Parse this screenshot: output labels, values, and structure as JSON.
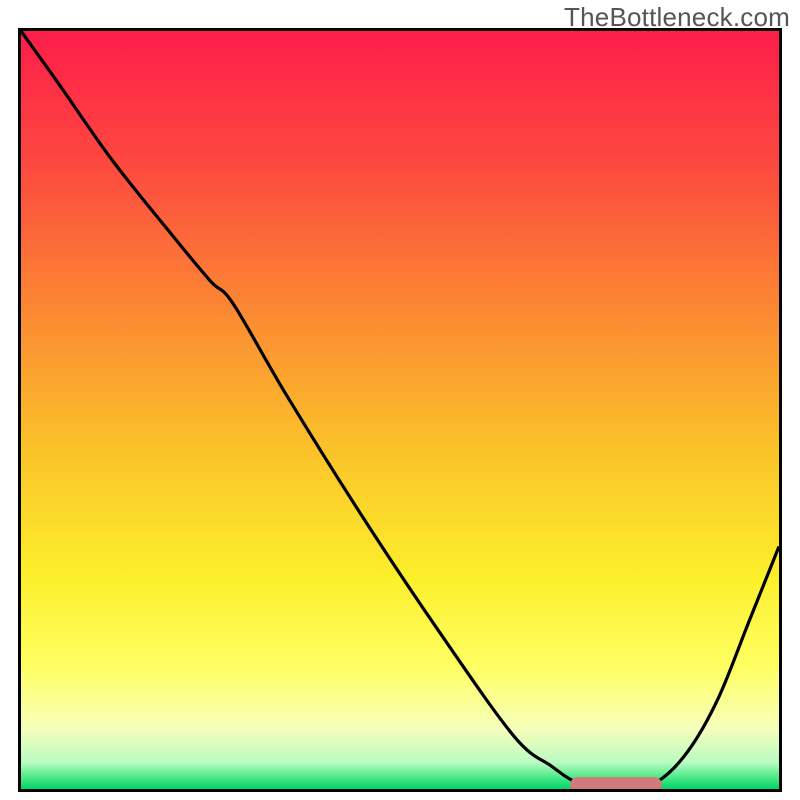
{
  "watermark": "TheBottleneck.com",
  "colors": {
    "frame": "#000000",
    "curve": "#000000",
    "marker": "#cf7b7d",
    "gradient_stops": [
      {
        "offset": 0.0,
        "color": "#fd1d4a"
      },
      {
        "offset": 0.18,
        "color": "#fd4a3f"
      },
      {
        "offset": 0.38,
        "color": "#fb8c32"
      },
      {
        "offset": 0.55,
        "color": "#fbc22a"
      },
      {
        "offset": 0.72,
        "color": "#fcef2b"
      },
      {
        "offset": 0.84,
        "color": "#feff63"
      },
      {
        "offset": 0.92,
        "color": "#f6ffba"
      },
      {
        "offset": 0.965,
        "color": "#b9fcc2"
      },
      {
        "offset": 0.985,
        "color": "#4be886"
      },
      {
        "offset": 1.0,
        "color": "#00d36b"
      }
    ]
  },
  "chart_data": {
    "type": "line",
    "title": "",
    "xlabel": "",
    "ylabel": "",
    "xlim": [
      0,
      100
    ],
    "ylim": [
      0,
      100
    ],
    "series": [
      {
        "name": "bottleneck-curve",
        "x": [
          0,
          5,
          12,
          20,
          25,
          28,
          35,
          45,
          55,
          65,
          70,
          73,
          76,
          80,
          84,
          88,
          92,
          96,
          100
        ],
        "y": [
          100,
          93,
          83,
          73,
          67,
          64,
          52,
          36,
          21,
          7,
          3,
          1,
          0,
          0,
          1,
          5,
          12,
          22,
          32
        ]
      }
    ],
    "markers": [
      {
        "name": "optimal-range",
        "x_start": 73,
        "x_end": 84,
        "y": 0
      }
    ],
    "annotations": [
      {
        "text": "TheBottleneck.com",
        "position": "top-right"
      }
    ]
  }
}
